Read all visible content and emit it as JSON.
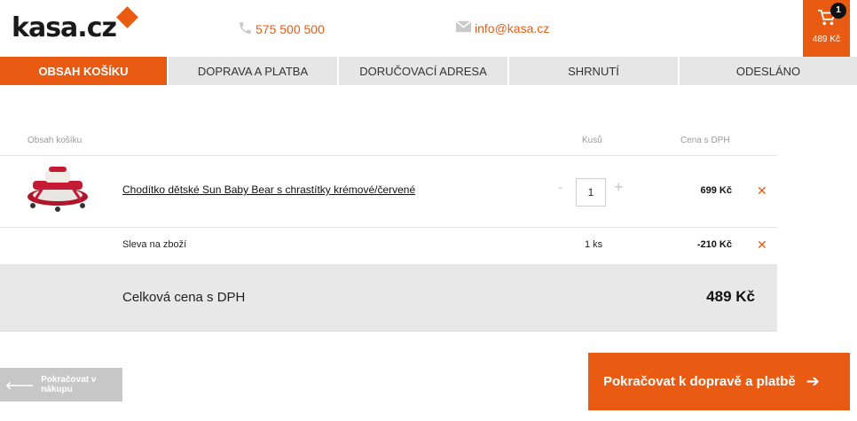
{
  "header": {
    "logo_text": "kasa.cz",
    "phone": "575 500 500",
    "email": "info@kasa.cz",
    "cart_count": "1",
    "cart_total": "489 Kč",
    "brand_color": "#e95b13"
  },
  "steps": [
    {
      "label": "OBSAH KOŠÍKU",
      "active": true
    },
    {
      "label": "DOPRAVA A PLATBA",
      "active": false
    },
    {
      "label": "DORUČOVACÍ ADRESA",
      "active": false
    },
    {
      "label": "SHRNUTÍ",
      "active": false
    },
    {
      "label": "ODESLÁNO",
      "active": false
    }
  ],
  "cart": {
    "columns": {
      "content": "Obsah košíku",
      "qty": "Kusů",
      "price": "Cena s DPH"
    },
    "item": {
      "name": "Chodítko dětské Sun Baby Bear s chrastítky krémové/červené",
      "qty_minus": "-",
      "qty": "1",
      "qty_plus": "+",
      "price": "699 Kč",
      "remove_icon": "close-icon"
    },
    "discount": {
      "label": "Sleva na zboží",
      "qty": "1 ks",
      "price": "-210 Kč",
      "remove_icon": "close-icon"
    },
    "total": {
      "label": "Celková cena s DPH",
      "value": "489 Kč"
    }
  },
  "buttons": {
    "back": "Pokračovat v nákupu",
    "next": "Pokračovat k dopravě a platbě"
  }
}
